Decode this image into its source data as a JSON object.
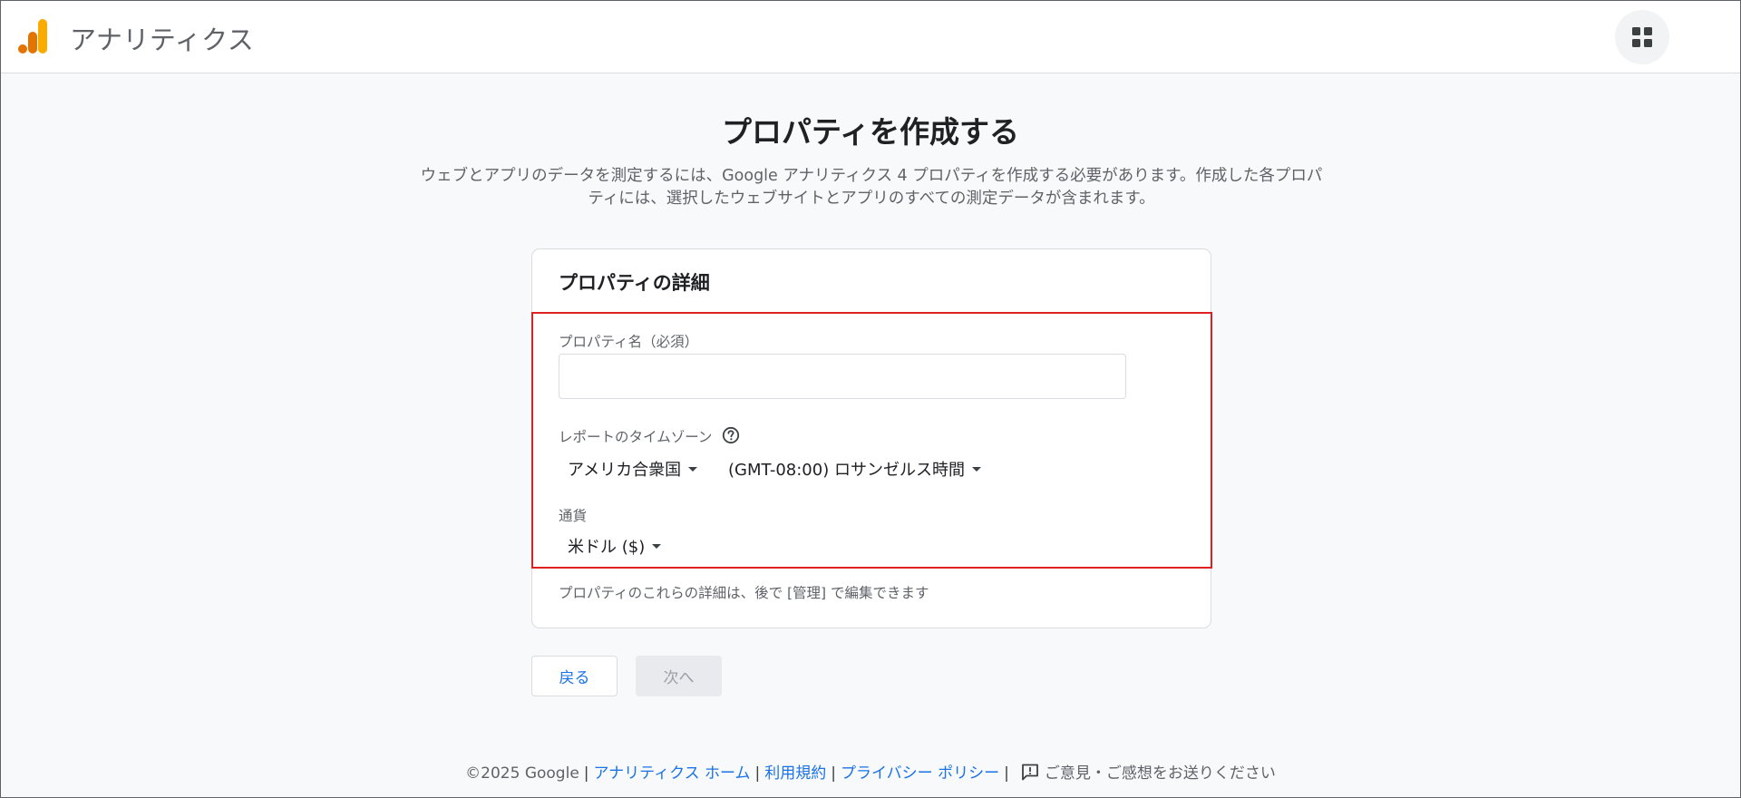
{
  "app": {
    "title": "アナリティクス",
    "brand_colors": [
      "#f9ab00",
      "#e37400"
    ]
  },
  "header": {
    "apps_icon": "apps-grid-icon"
  },
  "page": {
    "title": "プロパティを作成する",
    "description": "ウェブとアプリのデータを測定するには、Google アナリティクス 4 プロパティを作成する必要があります。作成した各プロパティには、選択したウェブサイトとアプリのすべての測定データが含まれます。"
  },
  "card": {
    "title": "プロパティの詳細",
    "property_name": {
      "label": "プロパティ名（必須）",
      "value": "",
      "placeholder": ""
    },
    "timezone": {
      "label": "レポートのタイムゾーン",
      "help_icon": "help-circle-icon",
      "country": "アメリカ合衆国",
      "zone": "(GMT-08:00) ロサンゼルス時間"
    },
    "currency": {
      "label": "通貨",
      "value": "米ドル ($)"
    },
    "note": "プロパティのこれらの詳細は、後で [管理] で編集できます"
  },
  "actions": {
    "back_label": "戻る",
    "next_label": "次へ"
  },
  "footer": {
    "copyright": "©2025 Google",
    "separator": "|",
    "links": {
      "home": "アナリティクス ホーム",
      "terms": "利用規約",
      "privacy": "プライバシー ポリシー"
    },
    "feedback_icon": "feedback-icon",
    "feedback": "ご意見・ご感想をお送りください"
  },
  "colors": {
    "accent": "#1a73e8",
    "highlight_border": "#e02020"
  }
}
